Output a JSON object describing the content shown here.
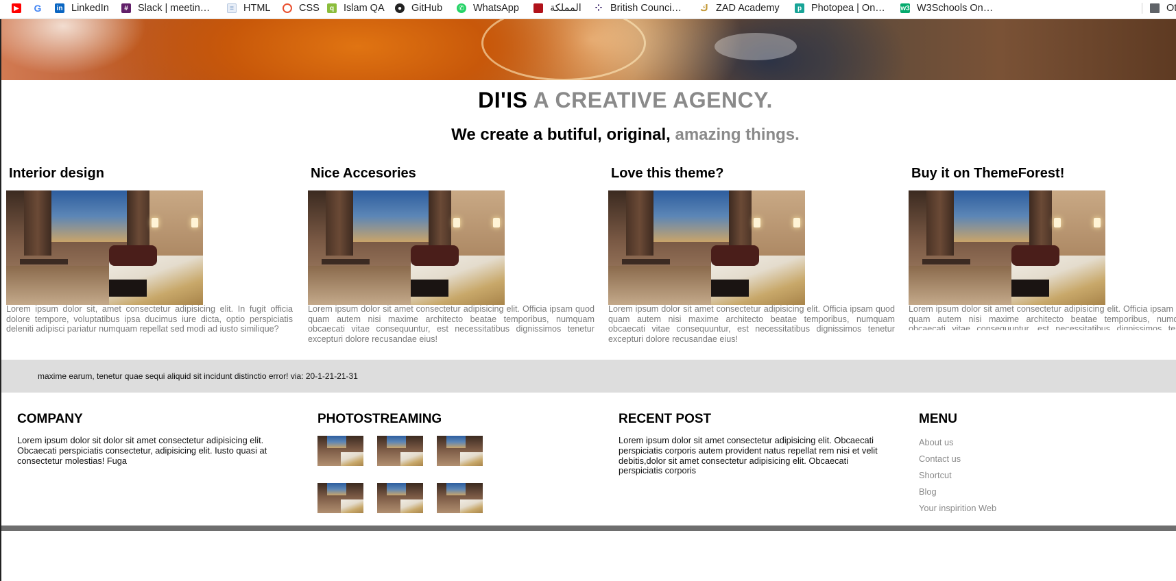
{
  "bookmarks": [
    {
      "label": "",
      "icon": "youtube-icon",
      "color": "#ff0000"
    },
    {
      "label": "",
      "icon": "google-icon",
      "color": "#4285f4"
    },
    {
      "label": "LinkedIn",
      "icon": "linkedin-icon",
      "color": "#0a66c2"
    },
    {
      "label": "Slack | meetin…",
      "icon": "slack-icon",
      "color": "#611f69"
    },
    {
      "label": "HTML",
      "icon": "document-icon",
      "color": "#7a9cc6"
    },
    {
      "label": "CSS",
      "icon": "css-icon",
      "color": "#e94f2e"
    },
    {
      "label": "Islam QA",
      "icon": "islamqa-icon",
      "color": "#8bbd3c"
    },
    {
      "label": "GitHub",
      "icon": "github-icon",
      "color": "#222222"
    },
    {
      "label": "WhatsApp",
      "icon": "whatsapp-icon",
      "color": "#25d366"
    },
    {
      "label": "المملكة",
      "icon": "almamlaka-icon",
      "color": "#b0121a"
    },
    {
      "label": "British Counci…",
      "icon": "british-council-icon",
      "color": "#23085a"
    },
    {
      "label": "ZAD Academy",
      "icon": "zad-academy-icon",
      "color": "#c49a3a"
    },
    {
      "label": "Photopea | On…",
      "icon": "photopea-icon",
      "color": "#18a497"
    },
    {
      "label": "W3Schools On…",
      "icon": "w3schools-icon",
      "color": "#04aa6d"
    },
    {
      "label": "Ot",
      "icon": "folder-icon",
      "color": "#5f6368"
    }
  ],
  "header": {
    "brand": "DI'IS",
    "tagline": "A CREATIVE AGENCY.",
    "sub_dark": "We create a butiful, original,",
    "sub_light": "amazing things."
  },
  "features": [
    {
      "title": "Interior design",
      "text": "Lorem ipsum dolor sit, amet consectetur adipisicing elit. In fugit officia dolore tempore, voluptatibus ipsa ducimus iure dicta, optio perspiciatis deleniti adipisci pariatur numquam repellat sed modi ad iusto similique?"
    },
    {
      "title": "Nice Accesories",
      "text": "Lorem ipsum dolor sit amet consectetur adipisicing elit. Officia ipsam quod quam autem nisi maxime architecto beatae temporibus, numquam obcaecati vitae consequuntur, est necessitatibus dignissimos tenetur excepturi dolore recusandae eius!"
    },
    {
      "title": "Love this theme?",
      "text": "Lorem ipsum dolor sit amet consectetur adipisicing elit. Officia ipsam quod quam autem nisi maxime architecto beatae temporibus, numquam obcaecati vitae consequuntur, est necessitatibus dignissimos tenetur excepturi dolore recusandae eius!"
    },
    {
      "title": "Buy it on ThemeForest!",
      "text": "Lorem ipsum dolor sit amet consectetur adipisicing elit. Officia ipsam quod quam autem nisi maxime architecto beatae temporibus, numquam obcaecati vitae consequuntur, est necessitatibus dignissimos tenetur excepturi dolore recusandae eius!"
    }
  ],
  "quote": {
    "text": "maxime earum, tenetur quae sequi aliquid sit incidunt distinctio error! via: 20-1-21-21-31"
  },
  "footer": {
    "company": {
      "title": "COMPANY",
      "text": "Lorem ipsum dolor sit dolor sit amet consectetur adipisicing elit. Obcaecati perspiciatis consectetur, adipisicing elit. Iusto quasi at consectetur molestias! Fuga"
    },
    "photostream": {
      "title": "PHOTOSTREAMING"
    },
    "recent": {
      "title": "RECENT POST",
      "text": "Lorem ipsum dolor sit amet consectetur adipisicing elit. Obcaecati perspiciatis corporis autem provident natus repellat rem nisi et velit debitis,dolor sit amet consectetur adipisicing elit. Obcaecati perspiciatis corporis"
    },
    "menu": {
      "title": "MENU",
      "items": [
        "About us",
        "Contact us",
        "Shortcut",
        "Blog",
        "Your inspirition Web"
      ]
    }
  },
  "colors": {
    "accent_gray": "#8a8a8a",
    "band": "#dddddd",
    "footer_bar": "#6e6e6e"
  }
}
